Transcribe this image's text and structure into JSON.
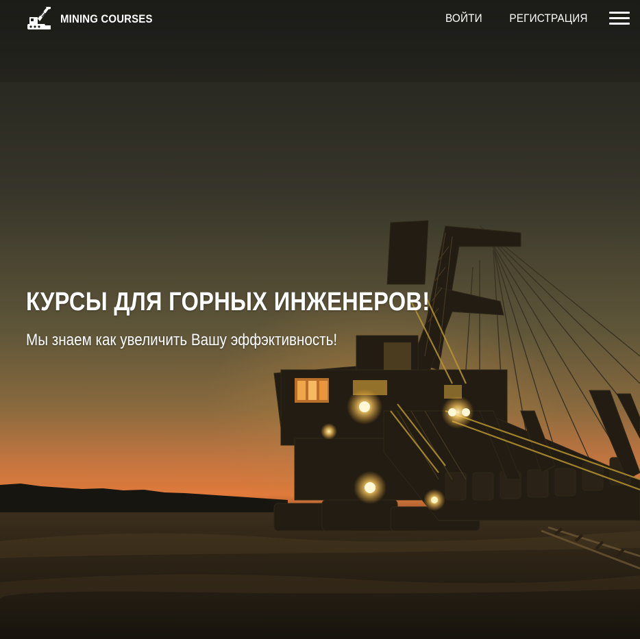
{
  "header": {
    "brand_name": "MINING COURSES",
    "logo_icon": "excavator-icon",
    "nav": [
      {
        "label": "ВОЙТИ"
      },
      {
        "label": "РЕГИСТРАЦИЯ"
      }
    ],
    "menu_icon": "hamburger-menu-icon"
  },
  "hero": {
    "title": "КУРСЫ ДЛЯ ГОРНЫХ ИНЖЕНЕРОВ!",
    "subtitle": "Мы знаем как увеличить Вашу эффэктивность!",
    "background": "bucket-wheel-excavator-at-sunset"
  },
  "colors": {
    "text": "#ffffff",
    "sky_top": "#22221c",
    "sky_mid": "#5a5238",
    "horizon_glow": "#d9773a",
    "ground": "#2a2216",
    "machine_light": "#ffd27a"
  }
}
